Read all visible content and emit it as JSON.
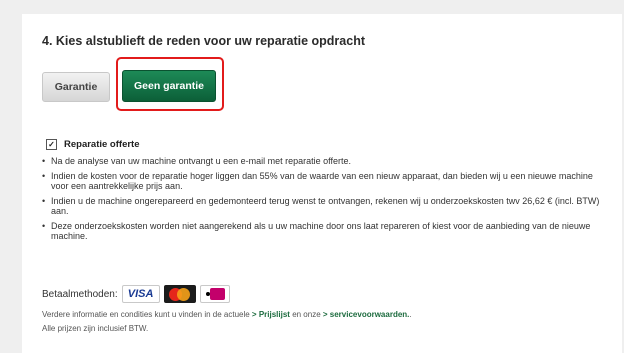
{
  "section": {
    "title": "4. Kies alstublieft de reden voor uw reparatie opdracht"
  },
  "buttons": {
    "garantie": "Garantie",
    "geen_garantie": "Geen garantie",
    "selected": "geen_garantie",
    "highlight_color": "#e21b1b",
    "primary_color": "#0c5f38"
  },
  "offerte": {
    "label": "Reparatie offerte",
    "checked": true,
    "check_mark": "✓"
  },
  "bullets": [
    "Na de analyse van uw machine ontvangt u een e-mail met reparatie offerte.",
    "Indien de kosten voor de reparatie hoger liggen dan 55% van de waarde van een nieuw apparaat, dan bieden wij u een nieuwe machine voor een aantrekkelijke prijs aan.",
    "Indien u de machine ongerepareerd en gedemonteerd terug wenst te ontvangen, rekenen wij u onderzoekskosten twv 26,62 € (incl. BTW) aan.",
    "Deze onderzoekskosten worden niet aangerekend als u uw machine door ons laat repareren of kiest voor de aanbieding van de nieuwe machine."
  ],
  "payment": {
    "label": "Betaalmethoden:",
    "visa_text": "VISA",
    "methods": [
      "visa-logo",
      "mastercard-logo",
      "ideal-logo"
    ]
  },
  "info": {
    "line1_prefix": "Verdere informatie en condities kunt u vinden in de actuele",
    "link1": "> Prijslijst",
    "line1_mid": "en onze",
    "link2": "> servicevoorwaarden.",
    "line1_suffix": ".",
    "line2": "Alle prijzen zijn inclusief BTW."
  }
}
